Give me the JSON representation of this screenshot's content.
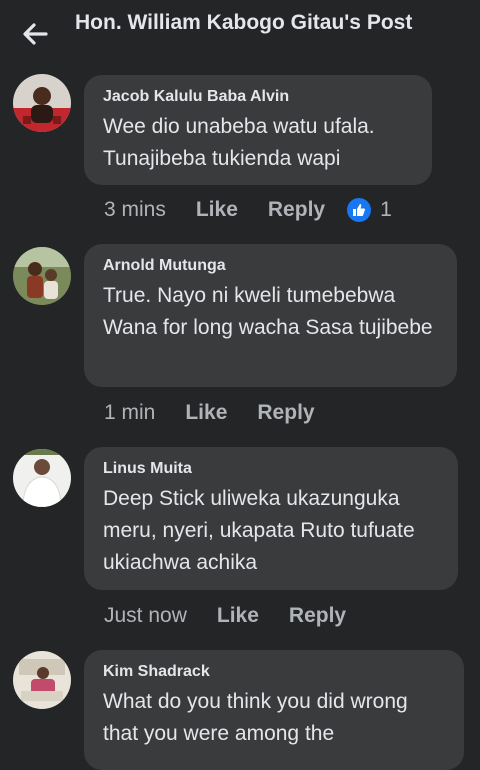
{
  "header": {
    "title": "Hon. William Kabogo Gitau's Post",
    "back_icon": "arrow-left-icon"
  },
  "colors": {
    "background": "#242526",
    "bubble": "#3a3b3c",
    "accent": "#1877f2",
    "muted": "#b0b3b8"
  },
  "comments": [
    {
      "author": "Jacob Kalulu Baba Alvin",
      "text": "Wee dio unabeba watu ufala. Tunajibeba tukienda wapi",
      "time": "3 mins",
      "like_label": "Like",
      "reply_label": "Reply",
      "reaction_icon": "thumbs-up-icon",
      "reaction_count": "1"
    },
    {
      "author": "Arnold Mutunga",
      "text": "True. Nayo ni kweli tumebebwa Wana for long wacha Sasa tujibebe",
      "time": "1 min",
      "like_label": "Like",
      "reply_label": "Reply"
    },
    {
      "author": "Linus Muita",
      "text": "Deep Stick uliweka ukazunguka meru, nyeri, ukapata Ruto tufuate ukiachwa achika",
      "time": "Just now",
      "like_label": "Like",
      "reply_label": "Reply"
    },
    {
      "author": "Kim Shadrack",
      "text": "What do you think you did wrong that you were among the"
    }
  ]
}
